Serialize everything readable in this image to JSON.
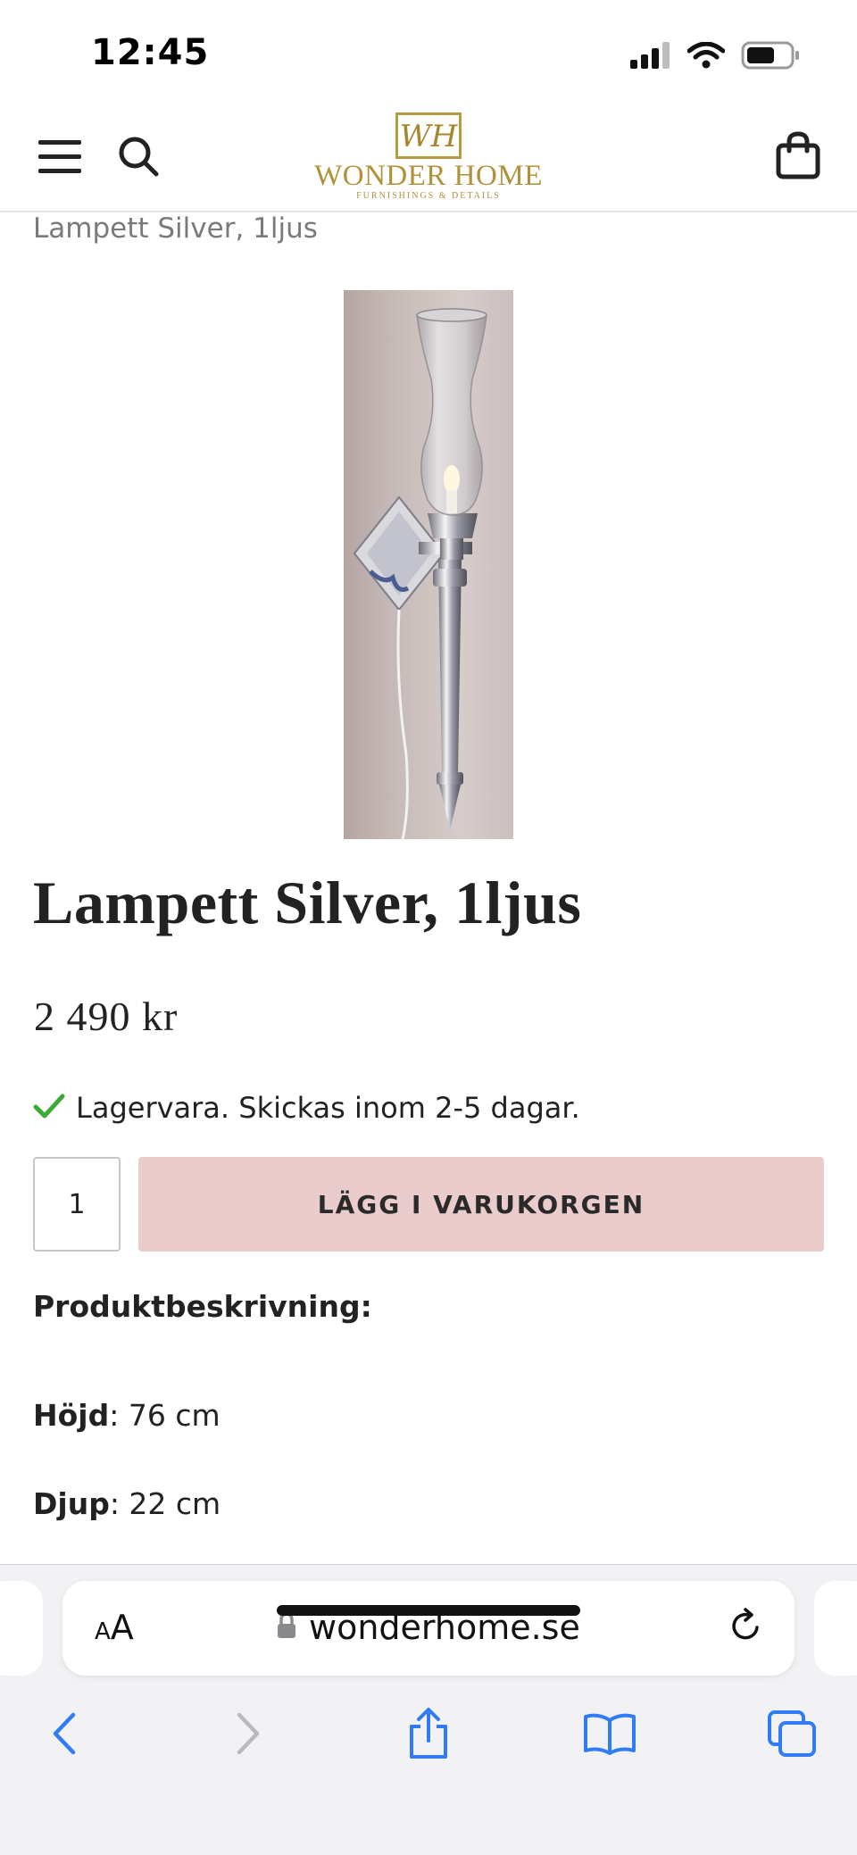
{
  "status_bar": {
    "time": "12:45",
    "icons": [
      "cellular-signal-icon",
      "wifi-icon",
      "battery-icon"
    ]
  },
  "header": {
    "menu_icon": "hamburger-menu-icon",
    "search_icon": "search-icon",
    "cart_icon": "shopping-bag-icon",
    "logo": {
      "monogram": "WH",
      "name": "WONDER HOME",
      "tagline": "FURNISHINGS & DETAILS"
    }
  },
  "breadcrumb": "Lampett Silver, 1ljus",
  "product": {
    "title": "Lampett Silver, 1ljus",
    "price": "2 490 kr",
    "stock_text": "Lagervara. Skickas inom 2-5 dagar.",
    "quantity": "1",
    "add_to_cart_label": "LÄGG I VARUKORGEN",
    "description_heading": "Produktbeskrivning:",
    "specs": [
      {
        "label": "Höjd",
        "value": ": 76 cm"
      },
      {
        "label": "Djup",
        "value": ": 22 cm"
      }
    ]
  },
  "browser": {
    "text_size_small": "A",
    "text_size_big": "A",
    "url": "wonderhome.se",
    "toolbar_icons": [
      "back-icon",
      "forward-icon",
      "share-icon",
      "bookmarks-icon",
      "tabs-icon"
    ]
  },
  "colors": {
    "accent_button": "#e9cccb",
    "logo_gold": "#b0923a",
    "ios_blue": "#2f7cf6",
    "stock_green": "#3aa935"
  }
}
